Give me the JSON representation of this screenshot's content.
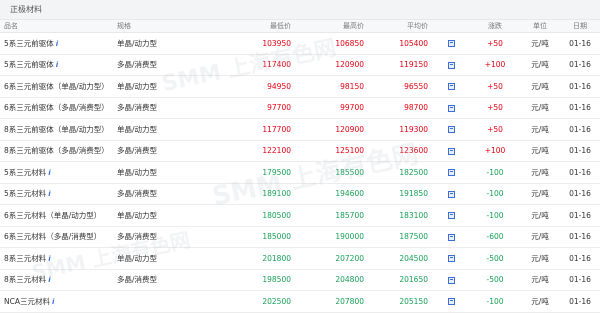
{
  "section": {
    "title": "正极材料"
  },
  "columns": {
    "name": "品名",
    "spec": "规格",
    "low": "最低价",
    "high": "最高价",
    "avg": "平均价",
    "chg": "涨跌",
    "unit": "单位",
    "date": "日期"
  },
  "rows": [
    {
      "name": "5系三元前驱体",
      "info": true,
      "spec": "单晶/动力型",
      "low": "103950",
      "high": "106850",
      "avg": "105400",
      "chg": "+50",
      "unit": "元/吨",
      "date": "01-16",
      "trend": "up"
    },
    {
      "name": "5系三元前驱体",
      "info": true,
      "spec": "多晶/消费型",
      "low": "117400",
      "high": "120900",
      "avg": "119150",
      "chg": "+100",
      "unit": "元/吨",
      "date": "01-16",
      "trend": "up"
    },
    {
      "name": "6系三元前驱体（单晶/动力型）",
      "info": false,
      "spec": "单晶/动力型",
      "low": "94950",
      "high": "98150",
      "avg": "96550",
      "chg": "+50",
      "unit": "元/吨",
      "date": "01-16",
      "trend": "up"
    },
    {
      "name": "6系三元前驱体（多晶/消费型）",
      "info": false,
      "spec": "多晶/消费型",
      "low": "97700",
      "high": "99700",
      "avg": "98700",
      "chg": "+50",
      "unit": "元/吨",
      "date": "01-16",
      "trend": "up"
    },
    {
      "name": "8系三元前驱体（单晶/动力型）",
      "info": false,
      "spec": "单晶/动力型",
      "low": "117700",
      "high": "120900",
      "avg": "119300",
      "chg": "+50",
      "unit": "元/吨",
      "date": "01-16",
      "trend": "up"
    },
    {
      "name": "8系三元前驱体（多晶/消费型）",
      "info": false,
      "spec": "多晶/消费型",
      "low": "122100",
      "high": "125100",
      "avg": "123600",
      "chg": "+100",
      "unit": "元/吨",
      "date": "01-16",
      "trend": "up"
    },
    {
      "name": "5系三元材料",
      "info": true,
      "spec": "单晶/动力型",
      "low": "179500",
      "high": "185500",
      "avg": "182500",
      "chg": "-100",
      "unit": "元/吨",
      "date": "01-16",
      "trend": "down"
    },
    {
      "name": "5系三元材料",
      "info": true,
      "spec": "多晶/消费型",
      "low": "189100",
      "high": "194600",
      "avg": "191850",
      "chg": "-100",
      "unit": "元/吨",
      "date": "01-16",
      "trend": "down"
    },
    {
      "name": "6系三元材料（单晶/动力型）",
      "info": false,
      "spec": "单晶/动力型",
      "low": "180500",
      "high": "185700",
      "avg": "183100",
      "chg": "-100",
      "unit": "元/吨",
      "date": "01-16",
      "trend": "down"
    },
    {
      "name": "6系三元材料（多晶/消费型）",
      "info": false,
      "spec": "多晶/消费型",
      "low": "185000",
      "high": "190000",
      "avg": "187500",
      "chg": "-600",
      "unit": "元/吨",
      "date": "01-16",
      "trend": "down"
    },
    {
      "name": "8系三元材料",
      "info": true,
      "spec": "单晶/动力型",
      "low": "201800",
      "high": "207200",
      "avg": "204500",
      "chg": "-500",
      "unit": "元/吨",
      "date": "01-16",
      "trend": "down"
    },
    {
      "name": "8系三元材料",
      "info": true,
      "spec": "多晶/消费型",
      "low": "198500",
      "high": "204800",
      "avg": "201650",
      "chg": "-500",
      "unit": "元/吨",
      "date": "01-16",
      "trend": "down"
    },
    {
      "name": "NCA三元材料",
      "info": true,
      "spec": "",
      "low": "202500",
      "high": "207800",
      "avg": "205150",
      "chg": "-100",
      "unit": "元/吨",
      "date": "01-16",
      "trend": "down"
    }
  ],
  "icons": {
    "info": "info-icon",
    "chart": "chart-icon"
  },
  "colors": {
    "up": "#e60012",
    "down": "#18a058",
    "accent": "#3b6fd8"
  },
  "watermark": {
    "text": "SMM 上海有色网"
  }
}
